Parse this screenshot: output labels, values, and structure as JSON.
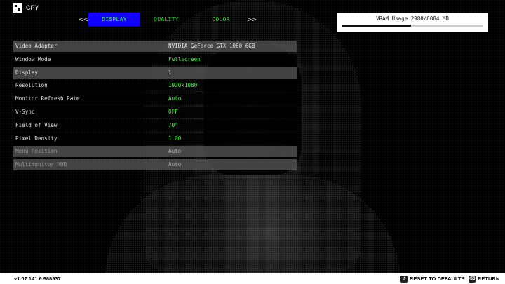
{
  "logo": {
    "label": "CPY"
  },
  "tabs": {
    "prev_arrow": "<<",
    "next_arrow": ">>",
    "items": [
      {
        "label": "DISPLAY",
        "active": true
      },
      {
        "label": "QUALITY",
        "active": false
      },
      {
        "label": "COLOR",
        "active": false
      }
    ]
  },
  "vram": {
    "label": "VRAM Usage 2980/6084 MB",
    "used": 2980,
    "total": 6084
  },
  "settings": [
    {
      "name": "Video Adapter",
      "value": "NVIDIA GeForce GTX 1060 6GB"
    },
    {
      "name": "Window Mode",
      "value": "Fullscreen"
    },
    {
      "name": "Display",
      "value": "1"
    },
    {
      "name": "Resolution",
      "value": "1920x1080"
    },
    {
      "name": "Monitor Refresh Rate",
      "value": "Auto"
    },
    {
      "name": "V-Sync",
      "value": "OFF"
    },
    {
      "name": "Field of View",
      "value": "70°"
    },
    {
      "name": "Pixel Density",
      "value": "1.00"
    },
    {
      "name": "Menu Position",
      "value": "Auto"
    },
    {
      "name": "Multimonitor HUD",
      "value": "Auto"
    }
  ],
  "footer": {
    "version": "v1.07.141.6.988937",
    "reset_label": "RESET TO DEFAULTS",
    "return_label": "RETURN",
    "reset_icon": "reset-key-icon",
    "return_icon": "escape-key-icon"
  },
  "colors": {
    "accent_tab": "#1400ff",
    "value_green": "#3dff3d",
    "background": "#000000"
  }
}
